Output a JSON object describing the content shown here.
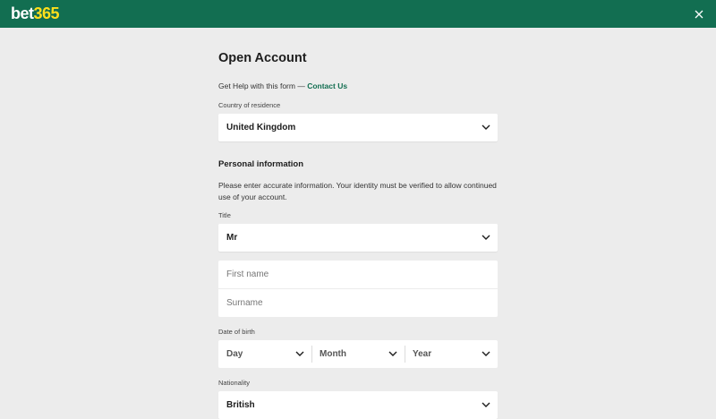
{
  "header": {
    "logo_part1": "bet",
    "logo_part2": "365"
  },
  "form": {
    "title": "Open Account",
    "help_text": "Get Help with this form — ",
    "help_link": "Contact Us",
    "country": {
      "label": "Country of residence",
      "value": "United Kingdom"
    },
    "personal": {
      "title": "Personal information",
      "description": "Please enter accurate information. Your identity must be verified to allow continued use of your account.",
      "title_field": {
        "label": "Title",
        "value": "Mr"
      },
      "first_name_placeholder": "First name",
      "surname_placeholder": "Surname",
      "dob": {
        "label": "Date of birth",
        "day": "Day",
        "month": "Month",
        "year": "Year"
      },
      "nationality": {
        "label": "Nationality",
        "value": "British"
      }
    }
  },
  "colors": {
    "brand_green": "#126e51",
    "logo_yellow": "#ffdf1b",
    "background": "#ececec"
  },
  "icons": [
    "close-icon",
    "chevron-down-icon"
  ]
}
